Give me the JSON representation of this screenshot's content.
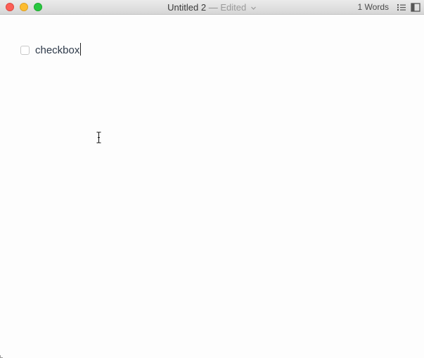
{
  "window": {
    "title": "Untitled 2",
    "separator": "—",
    "status": "Edited",
    "word_count": "1 Words"
  },
  "toolbar": {
    "icons": [
      "outline-icon",
      "sidebar-toggle-icon"
    ]
  },
  "document": {
    "tasks": [
      {
        "text": "checkbox",
        "checked": false
      }
    ]
  },
  "colors": {
    "close": "#fc5f57",
    "minimize": "#fdbc2e",
    "zoom": "#28c840",
    "text": "#2e3a4a"
  }
}
